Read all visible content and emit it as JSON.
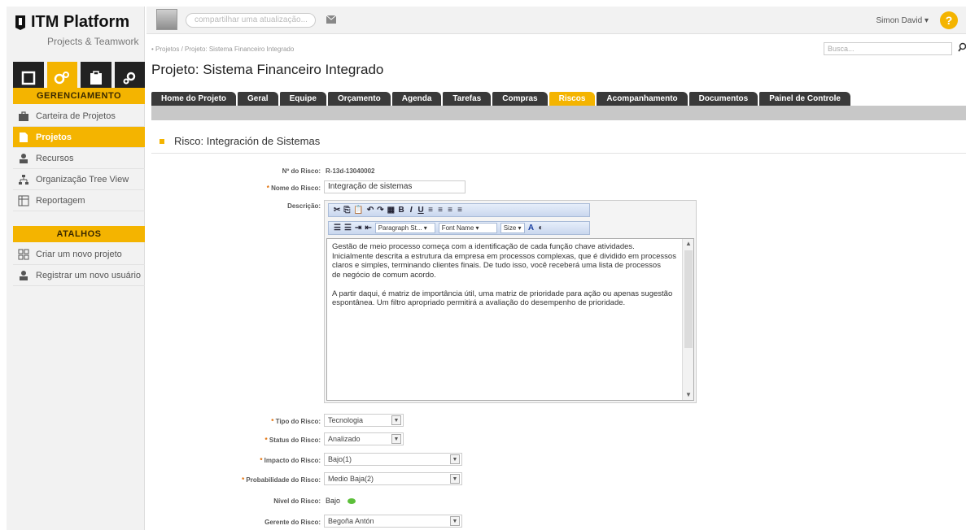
{
  "app": {
    "logo_name": "ITM Platform",
    "logo_sub": "Projects & Teamwork"
  },
  "sidebar": {
    "section_management": "GERENCIAMENTO",
    "items": [
      {
        "label": "Carteira de Projetos",
        "icon": "briefcase-icon"
      },
      {
        "label": "Projetos",
        "icon": "document-icon"
      },
      {
        "label": "Recursos",
        "icon": "person-icon"
      },
      {
        "label": "Organização Tree View",
        "icon": "org-chart-icon"
      },
      {
        "label": "Reportagem",
        "icon": "report-icon"
      }
    ],
    "section_shortcuts": "ATALHOS",
    "shortcuts": [
      {
        "label": "Criar um novo projeto",
        "icon": "new-project-icon"
      },
      {
        "label": "Registrar um novo usuário",
        "icon": "person-icon"
      }
    ]
  },
  "topbar": {
    "share_placeholder": "compartilhar uma atualização...",
    "user_name": "Simon David ▾",
    "help": "?"
  },
  "header": {
    "breadcrumb": "• Projetos / Projeto: Sistema Financeiro Integrado",
    "search_placeholder": "Busca...",
    "title": "Projeto: Sistema Financeiro Integrado"
  },
  "tabs": [
    {
      "label": "Home do Projeto",
      "active": false
    },
    {
      "label": "Geral",
      "active": false
    },
    {
      "label": "Equipe",
      "active": false
    },
    {
      "label": "Orçamento",
      "active": false
    },
    {
      "label": "Agenda",
      "active": false
    },
    {
      "label": "Tarefas",
      "active": false
    },
    {
      "label": "Compras",
      "active": false
    },
    {
      "label": "Riscos",
      "active": true
    },
    {
      "label": "Acompanhamento",
      "active": false
    },
    {
      "label": "Documentos",
      "active": false
    },
    {
      "label": "Painel de Controle",
      "active": false
    }
  ],
  "risk": {
    "heading": "Risco: Integración de Sistemas",
    "number_label": "Nº do Risco:",
    "number_value": "R-13d-13040002",
    "name_label": "Nome do Risco:",
    "name_value": "Integração de sistemas",
    "description_label": "Descrição:",
    "editor": {
      "paragraph_style": "Paragraph St...",
      "font_name": "Font Name",
      "size": "Size",
      "text_color": "A"
    },
    "description_paragraphs": [
      "Gestão de meio processo começa com a identificação de cada função chave atividades. Inicialmente descrita a estrutura da empresa em processos complexas, que é dividido em processos claros e simples, terminando clientes finais. De tudo isso, você receberá uma lista de processos",
      "de negócio de comum acordo.",
      "",
      "A partir daqui, é matriz de importância útil, uma matriz de prioridade para ação ou apenas sugestão espontânea. Um filtro apropriado permitirá a avaliação do desempenho de prioridade."
    ],
    "type_label": "Tipo do Risco:",
    "type_value": "Tecnologia",
    "status_label": "Status do Risco:",
    "status_value": "Analizado",
    "impact_label": "Impacto do Risco:",
    "impact_value": "Bajo(1)",
    "probability_label": "Probabilidade do Risco:",
    "probability_value": "Medio Baja(2)",
    "level_label": "Nível do Risco:",
    "level_value": "Bajo",
    "level_color": "#5cbf3a",
    "manager_label": "Gerente do Risco:",
    "manager_value": "Begoña Antón"
  },
  "colors": {
    "accent": "#f4b400",
    "tab_dark": "#3a3a3a"
  }
}
